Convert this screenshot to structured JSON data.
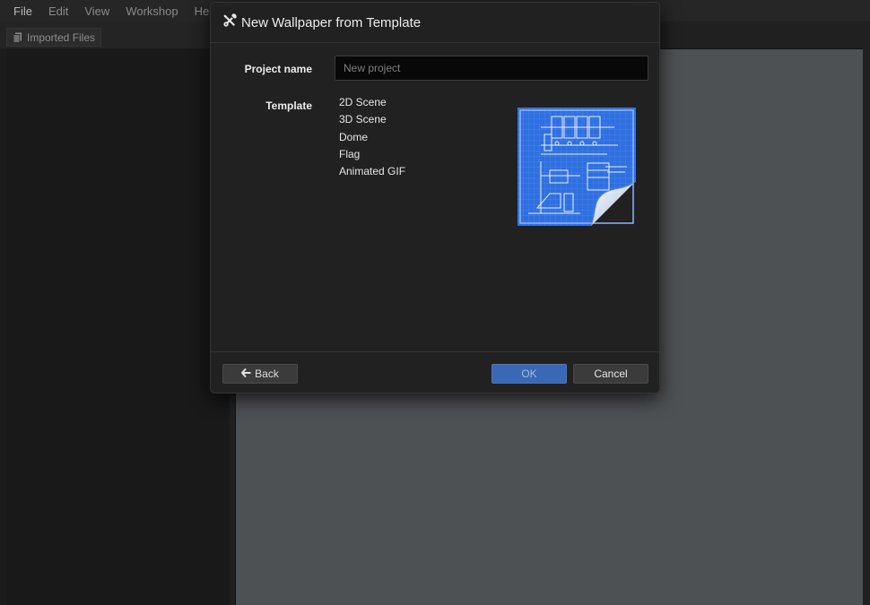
{
  "menubar": {
    "items": [
      "File",
      "Edit",
      "View",
      "Workshop",
      "Help"
    ]
  },
  "left_panel": {
    "tab_label": "Imported Files",
    "tab_icon": "files-icon"
  },
  "dialog": {
    "title": "New Wallpaper from Template",
    "title_icon": "tools-icon",
    "project_name": {
      "label": "Project name",
      "placeholder": "New project",
      "value": ""
    },
    "template": {
      "label": "Template",
      "options": [
        "2D Scene",
        "3D Scene",
        "Dome",
        "Flag",
        "Animated GIF"
      ],
      "preview_icon": "blueprint-page-icon"
    },
    "buttons": {
      "back": "Back",
      "back_icon": "arrow-left-icon",
      "ok": "OK",
      "cancel": "Cancel"
    }
  },
  "colors": {
    "accent": "#3a68b5",
    "blueprint": "#2f6fe0",
    "viewport": "#4e5154"
  }
}
